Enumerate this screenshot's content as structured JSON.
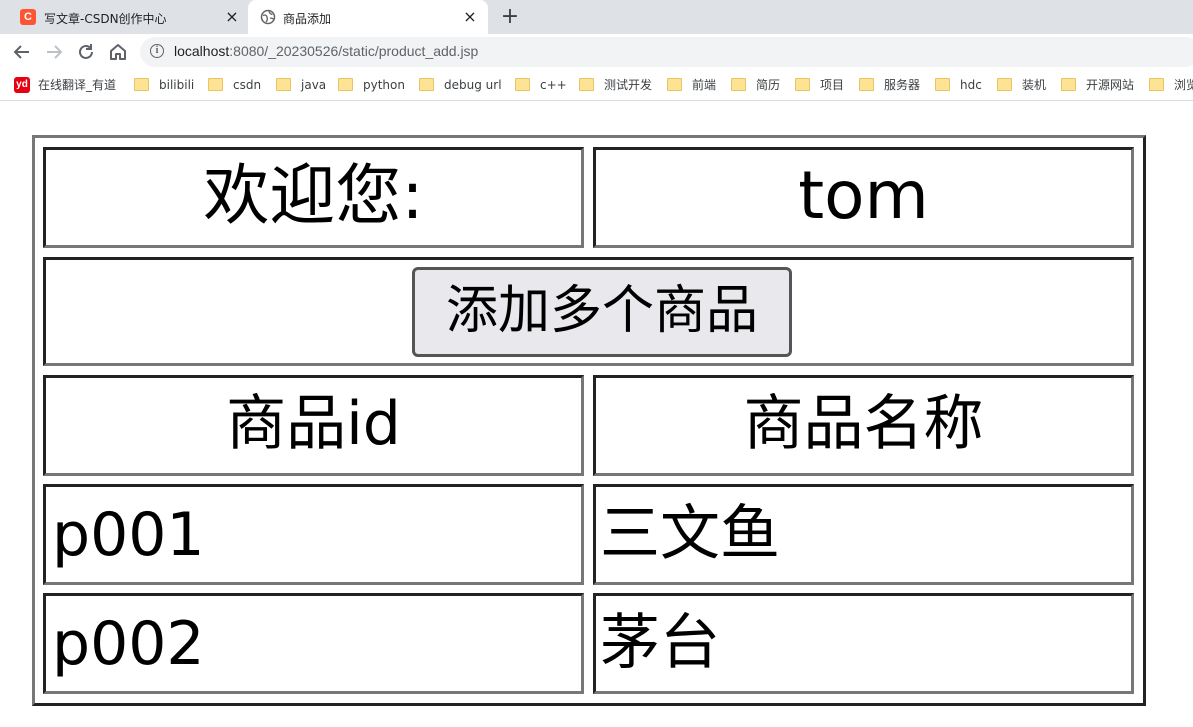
{
  "browser": {
    "tabs": [
      {
        "title": "写文章-CSDN创作中心",
        "icon": "csdn-icon",
        "active": false
      },
      {
        "title": "商品添加",
        "icon": "globe-icon",
        "active": true
      }
    ],
    "url": {
      "host": "localhost",
      "rest": ":8080/_20230526/static/product_add.jsp"
    },
    "bookmarks": [
      {
        "label": "在线翻译_有道",
        "icon": "youdao-icon"
      },
      {
        "label": "bilibili",
        "icon": "folder-icon"
      },
      {
        "label": "csdn",
        "icon": "folder-icon"
      },
      {
        "label": "java",
        "icon": "folder-icon"
      },
      {
        "label": "python",
        "icon": "folder-icon"
      },
      {
        "label": "debug url",
        "icon": "folder-icon"
      },
      {
        "label": "c++",
        "icon": "folder-icon"
      },
      {
        "label": "测试开发",
        "icon": "folder-icon"
      },
      {
        "label": "前端",
        "icon": "folder-icon"
      },
      {
        "label": "简历",
        "icon": "folder-icon"
      },
      {
        "label": "项目",
        "icon": "folder-icon"
      },
      {
        "label": "服务器",
        "icon": "folder-icon"
      },
      {
        "label": "hdc",
        "icon": "folder-icon"
      },
      {
        "label": "装机",
        "icon": "folder-icon"
      },
      {
        "label": "开源网站",
        "icon": "folder-icon"
      },
      {
        "label": "浏览",
        "icon": "folder-icon"
      }
    ]
  },
  "page": {
    "welcome_label": "欢迎您:",
    "username": "tom",
    "add_button_label": "添加多个商品",
    "table": {
      "headers": [
        "商品id",
        "商品名称"
      ],
      "rows": [
        [
          "p001",
          "三文鱼"
        ],
        [
          "p002",
          "茅台"
        ]
      ]
    }
  }
}
